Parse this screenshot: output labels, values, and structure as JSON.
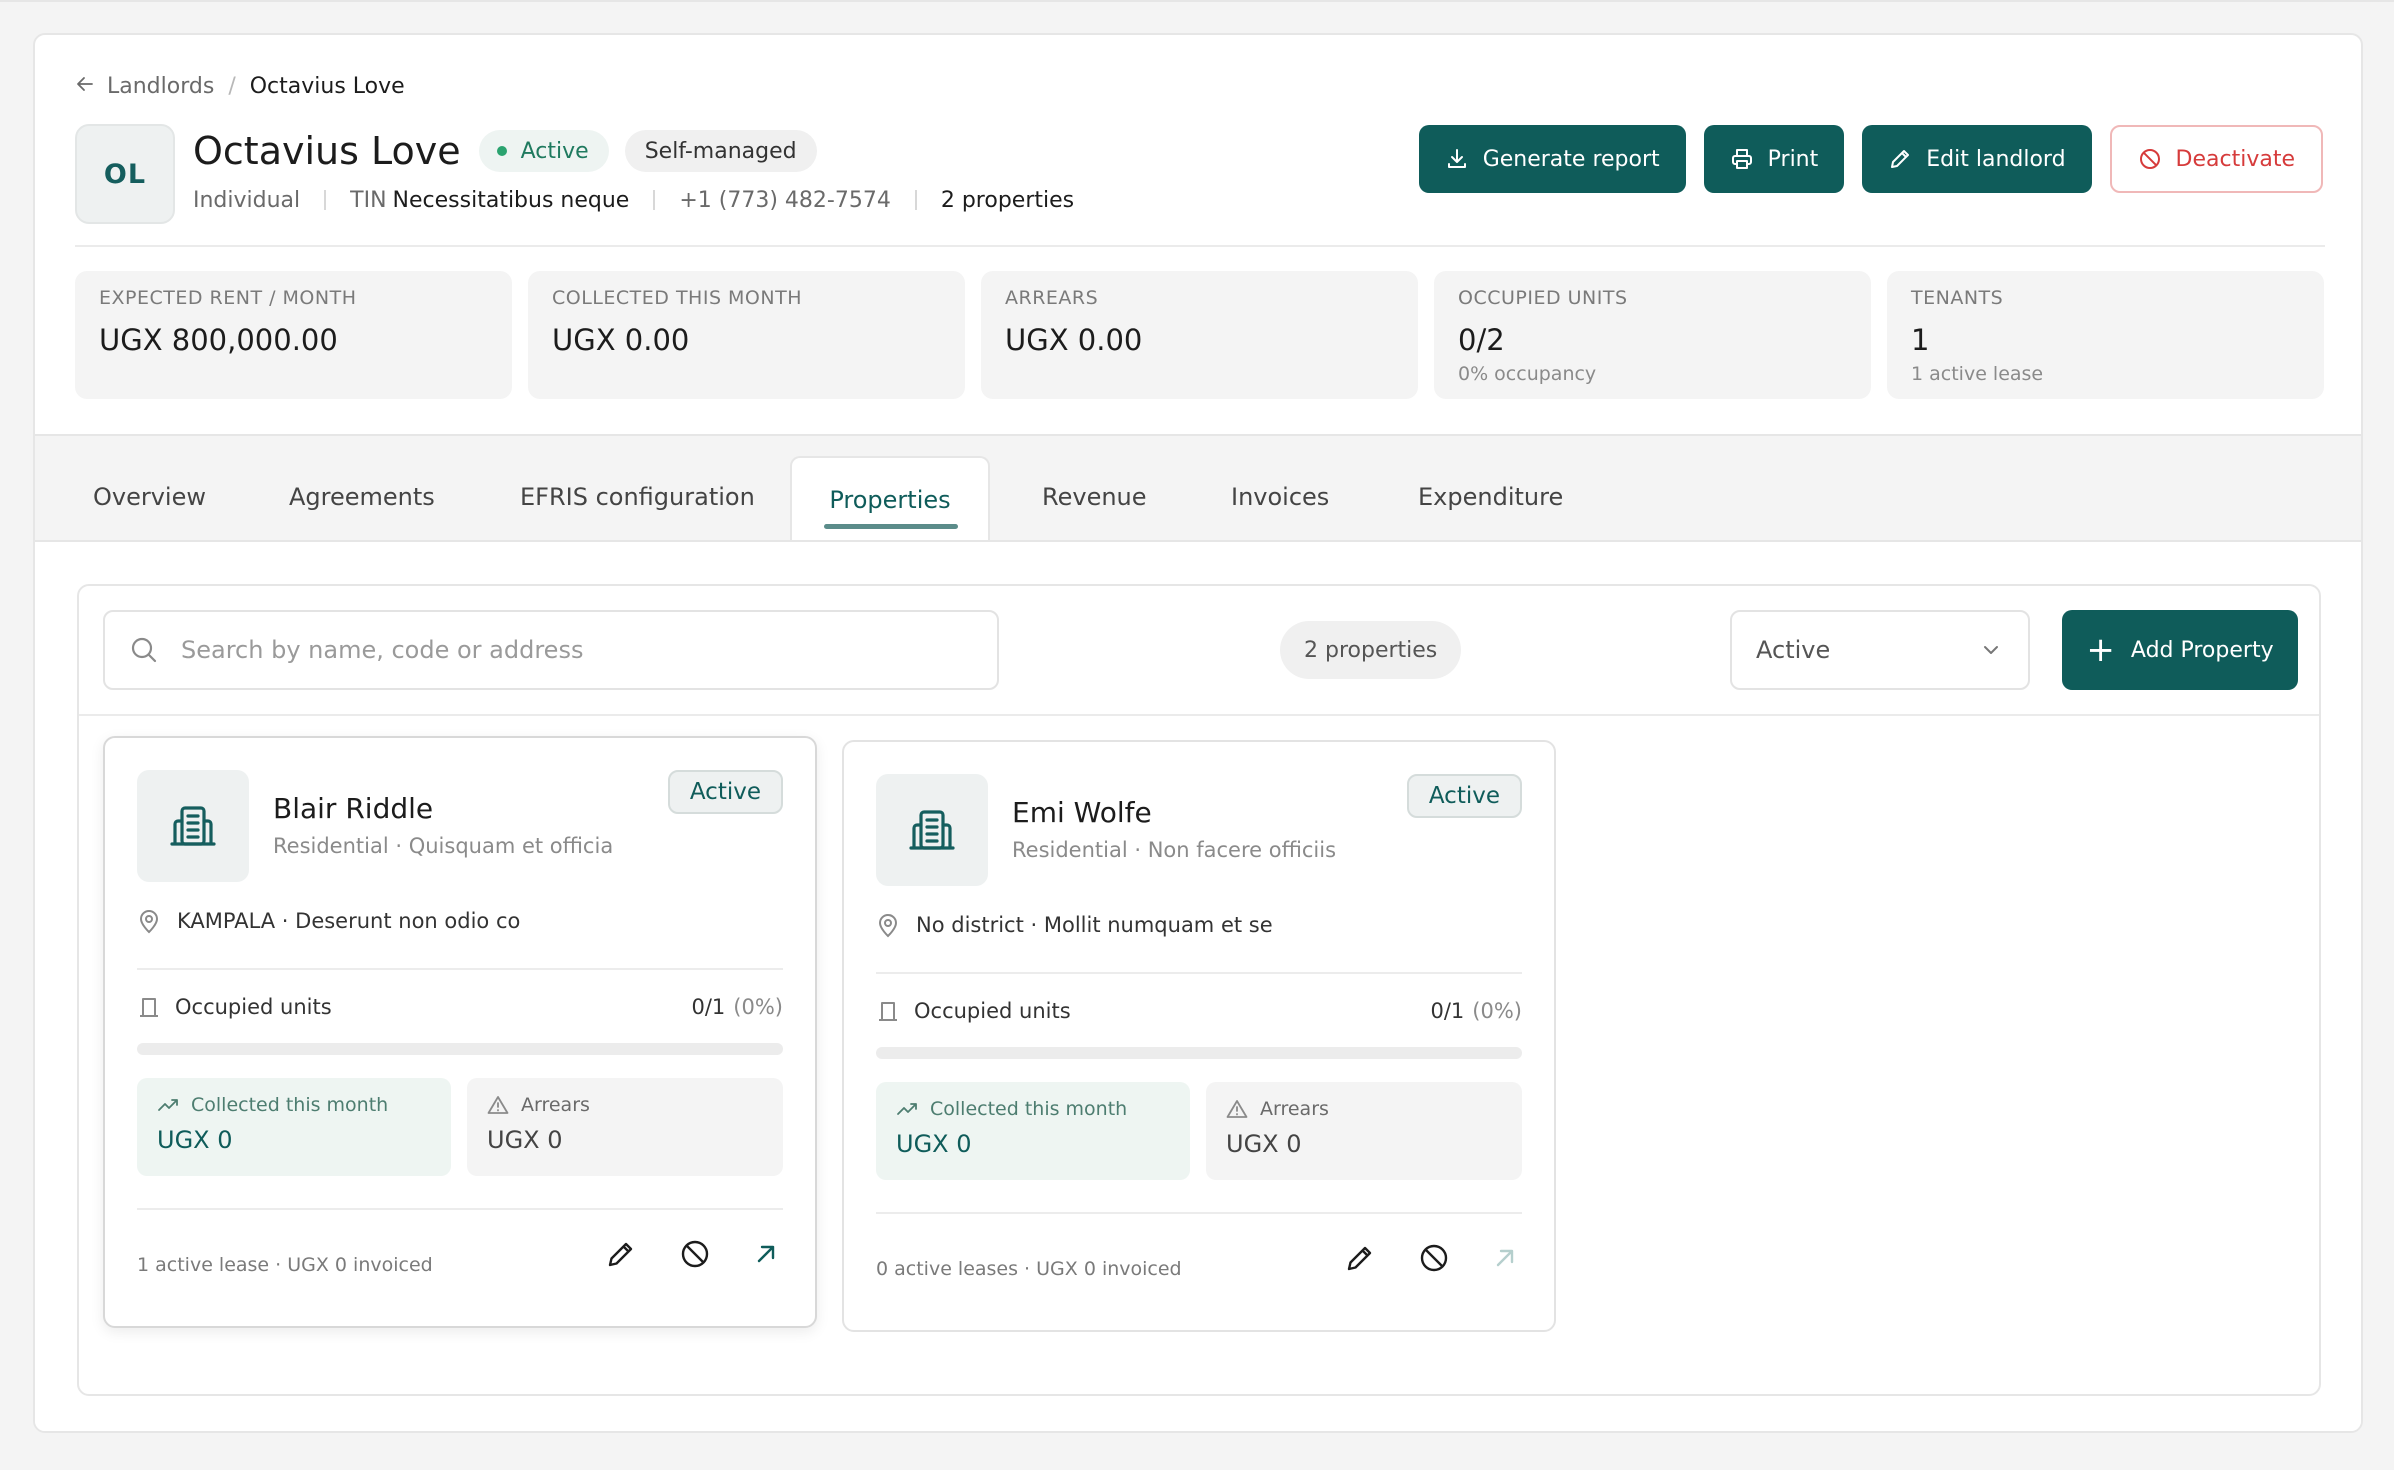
{
  "breadcrumb": {
    "parent": "Landlords",
    "separator": "/",
    "current": "Octavius Love"
  },
  "landlord": {
    "initials": "OL",
    "name": "Octavius Love",
    "status": "Active",
    "management": "Self-managed",
    "type": "Individual",
    "tin_label": "TIN",
    "tin_value": "Necessitatibus neque",
    "phone": "+1 (773) 482-7574",
    "properties_count": "2 properties"
  },
  "actions": {
    "generate_report": "Generate report",
    "print": "Print",
    "edit": "Edit landlord",
    "deactivate": "Deactivate"
  },
  "stats": [
    {
      "label": "EXPECTED RENT / MONTH",
      "value": "UGX 800,000.00",
      "sub": ""
    },
    {
      "label": "COLLECTED THIS MONTH",
      "value": "UGX 0.00",
      "sub": ""
    },
    {
      "label": "ARREARS",
      "value": "UGX 0.00",
      "sub": ""
    },
    {
      "label": "OCCUPIED UNITS",
      "value": "0/2",
      "sub": "0% occupancy"
    },
    {
      "label": "TENANTS",
      "value": "1",
      "sub": "1 active lease"
    }
  ],
  "tabs": [
    "Overview",
    "Agreements",
    "EFRIS configuration",
    "Properties",
    "Revenue",
    "Invoices",
    "Expenditure"
  ],
  "active_tab": "Properties",
  "properties_toolbar": {
    "search_placeholder": "Search by name, code or address",
    "count": "2 properties",
    "filter_value": "Active",
    "add_label": "Add Property"
  },
  "properties": [
    {
      "name": "Blair Riddle",
      "subtitle": "Residential · Quisquam et officia",
      "status": "Active",
      "location": "KAMPALA · Deserunt non odio co",
      "occupied_label": "Occupied units",
      "occupied_value": "0/1",
      "occupied_pct": "(0%)",
      "occupancy_fraction": 0,
      "collected_label": "Collected this month",
      "collected_value": "UGX 0",
      "arrears_label": "Arrears",
      "arrears_value": "UGX 0",
      "footer": "1 active lease · UGX 0 invoiced"
    },
    {
      "name": "Emi Wolfe",
      "subtitle": "Residential · Non facere officiis",
      "status": "Active",
      "location": "No district · Mollit numquam et se",
      "occupied_label": "Occupied units",
      "occupied_value": "0/1",
      "occupied_pct": "(0%)",
      "occupancy_fraction": 0,
      "collected_label": "Collected this month",
      "collected_value": "UGX 0",
      "arrears_label": "Arrears",
      "arrears_value": "UGX 0",
      "footer": "0 active leases · UGX 0 invoiced"
    }
  ],
  "colors": {
    "accent": "#0f5c5a",
    "danger": "#d63b3b",
    "status_green": "#2aa36f"
  }
}
